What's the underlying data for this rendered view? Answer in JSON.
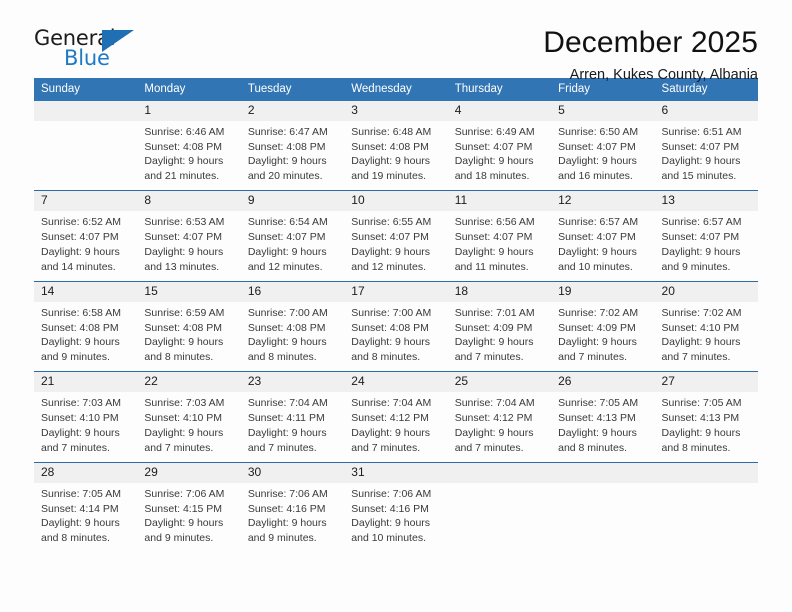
{
  "logo": {
    "word_top": "General",
    "word_bottom": "Blue",
    "triangle_icon": "triangle-icon",
    "accent_color": "#1f7ac4"
  },
  "header": {
    "title": "December 2025",
    "subtitle": "Arren, Kukes County, Albania"
  },
  "calendar": {
    "header_bg": "#3275b4",
    "header_text_color": "#ffffff",
    "daynum_bg": "#f0f0f0",
    "row_border_color": "#2a6ca8",
    "weekday_headers": [
      "Sunday",
      "Monday",
      "Tuesday",
      "Wednesday",
      "Thursday",
      "Friday",
      "Saturday"
    ],
    "weeks": [
      [
        {
          "day": "",
          "lines": []
        },
        {
          "day": "1",
          "lines": [
            "Sunrise: 6:46 AM",
            "Sunset: 4:08 PM",
            "Daylight: 9 hours",
            "and 21 minutes."
          ]
        },
        {
          "day": "2",
          "lines": [
            "Sunrise: 6:47 AM",
            "Sunset: 4:08 PM",
            "Daylight: 9 hours",
            "and 20 minutes."
          ]
        },
        {
          "day": "3",
          "lines": [
            "Sunrise: 6:48 AM",
            "Sunset: 4:08 PM",
            "Daylight: 9 hours",
            "and 19 minutes."
          ]
        },
        {
          "day": "4",
          "lines": [
            "Sunrise: 6:49 AM",
            "Sunset: 4:07 PM",
            "Daylight: 9 hours",
            "and 18 minutes."
          ]
        },
        {
          "day": "5",
          "lines": [
            "Sunrise: 6:50 AM",
            "Sunset: 4:07 PM",
            "Daylight: 9 hours",
            "and 16 minutes."
          ]
        },
        {
          "day": "6",
          "lines": [
            "Sunrise: 6:51 AM",
            "Sunset: 4:07 PM",
            "Daylight: 9 hours",
            "and 15 minutes."
          ]
        }
      ],
      [
        {
          "day": "7",
          "lines": [
            "Sunrise: 6:52 AM",
            "Sunset: 4:07 PM",
            "Daylight: 9 hours",
            "and 14 minutes."
          ]
        },
        {
          "day": "8",
          "lines": [
            "Sunrise: 6:53 AM",
            "Sunset: 4:07 PM",
            "Daylight: 9 hours",
            "and 13 minutes."
          ]
        },
        {
          "day": "9",
          "lines": [
            "Sunrise: 6:54 AM",
            "Sunset: 4:07 PM",
            "Daylight: 9 hours",
            "and 12 minutes."
          ]
        },
        {
          "day": "10",
          "lines": [
            "Sunrise: 6:55 AM",
            "Sunset: 4:07 PM",
            "Daylight: 9 hours",
            "and 12 minutes."
          ]
        },
        {
          "day": "11",
          "lines": [
            "Sunrise: 6:56 AM",
            "Sunset: 4:07 PM",
            "Daylight: 9 hours",
            "and 11 minutes."
          ]
        },
        {
          "day": "12",
          "lines": [
            "Sunrise: 6:57 AM",
            "Sunset: 4:07 PM",
            "Daylight: 9 hours",
            "and 10 minutes."
          ]
        },
        {
          "day": "13",
          "lines": [
            "Sunrise: 6:57 AM",
            "Sunset: 4:07 PM",
            "Daylight: 9 hours",
            "and 9 minutes."
          ]
        }
      ],
      [
        {
          "day": "14",
          "lines": [
            "Sunrise: 6:58 AM",
            "Sunset: 4:08 PM",
            "Daylight: 9 hours",
            "and 9 minutes."
          ]
        },
        {
          "day": "15",
          "lines": [
            "Sunrise: 6:59 AM",
            "Sunset: 4:08 PM",
            "Daylight: 9 hours",
            "and 8 minutes."
          ]
        },
        {
          "day": "16",
          "lines": [
            "Sunrise: 7:00 AM",
            "Sunset: 4:08 PM",
            "Daylight: 9 hours",
            "and 8 minutes."
          ]
        },
        {
          "day": "17",
          "lines": [
            "Sunrise: 7:00 AM",
            "Sunset: 4:08 PM",
            "Daylight: 9 hours",
            "and 8 minutes."
          ]
        },
        {
          "day": "18",
          "lines": [
            "Sunrise: 7:01 AM",
            "Sunset: 4:09 PM",
            "Daylight: 9 hours",
            "and 7 minutes."
          ]
        },
        {
          "day": "19",
          "lines": [
            "Sunrise: 7:02 AM",
            "Sunset: 4:09 PM",
            "Daylight: 9 hours",
            "and 7 minutes."
          ]
        },
        {
          "day": "20",
          "lines": [
            "Sunrise: 7:02 AM",
            "Sunset: 4:10 PM",
            "Daylight: 9 hours",
            "and 7 minutes."
          ]
        }
      ],
      [
        {
          "day": "21",
          "lines": [
            "Sunrise: 7:03 AM",
            "Sunset: 4:10 PM",
            "Daylight: 9 hours",
            "and 7 minutes."
          ]
        },
        {
          "day": "22",
          "lines": [
            "Sunrise: 7:03 AM",
            "Sunset: 4:10 PM",
            "Daylight: 9 hours",
            "and 7 minutes."
          ]
        },
        {
          "day": "23",
          "lines": [
            "Sunrise: 7:04 AM",
            "Sunset: 4:11 PM",
            "Daylight: 9 hours",
            "and 7 minutes."
          ]
        },
        {
          "day": "24",
          "lines": [
            "Sunrise: 7:04 AM",
            "Sunset: 4:12 PM",
            "Daylight: 9 hours",
            "and 7 minutes."
          ]
        },
        {
          "day": "25",
          "lines": [
            "Sunrise: 7:04 AM",
            "Sunset: 4:12 PM",
            "Daylight: 9 hours",
            "and 7 minutes."
          ]
        },
        {
          "day": "26",
          "lines": [
            "Sunrise: 7:05 AM",
            "Sunset: 4:13 PM",
            "Daylight: 9 hours",
            "and 8 minutes."
          ]
        },
        {
          "day": "27",
          "lines": [
            "Sunrise: 7:05 AM",
            "Sunset: 4:13 PM",
            "Daylight: 9 hours",
            "and 8 minutes."
          ]
        }
      ],
      [
        {
          "day": "28",
          "lines": [
            "Sunrise: 7:05 AM",
            "Sunset: 4:14 PM",
            "Daylight: 9 hours",
            "and 8 minutes."
          ]
        },
        {
          "day": "29",
          "lines": [
            "Sunrise: 7:06 AM",
            "Sunset: 4:15 PM",
            "Daylight: 9 hours",
            "and 9 minutes."
          ]
        },
        {
          "day": "30",
          "lines": [
            "Sunrise: 7:06 AM",
            "Sunset: 4:16 PM",
            "Daylight: 9 hours",
            "and 9 minutes."
          ]
        },
        {
          "day": "31",
          "lines": [
            "Sunrise: 7:06 AM",
            "Sunset: 4:16 PM",
            "Daylight: 9 hours",
            "and 10 minutes."
          ]
        },
        {
          "day": "",
          "lines": []
        },
        {
          "day": "",
          "lines": []
        },
        {
          "day": "",
          "lines": []
        }
      ]
    ]
  }
}
